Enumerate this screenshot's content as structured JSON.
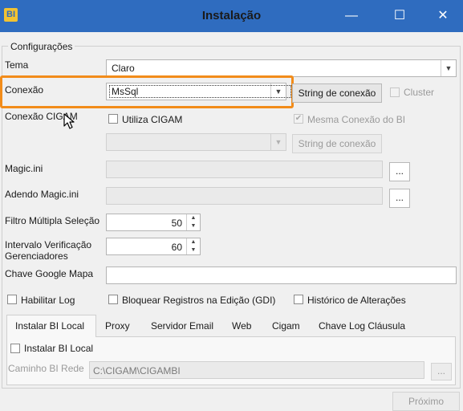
{
  "window": {
    "logo_text": "BI",
    "title": "Instalação",
    "minimize_glyph": "—",
    "maximize_glyph": "☐",
    "close_glyph": "✕"
  },
  "group": {
    "legend": "Configurações"
  },
  "tema": {
    "label": "Tema",
    "value": "Claro"
  },
  "conexao": {
    "label": "Conexão",
    "value": "MsSql",
    "string_button": "String de conexão",
    "cluster_label": "Cluster"
  },
  "conexao_cigam": {
    "label": "Conexão CIGAM",
    "utiliza_label": "Utiliza CIGAM",
    "mesma_conexao_label": "Mesma Conexão do BI",
    "combo_value": "",
    "string_button": "String de conexão"
  },
  "magic_ini": {
    "label": "Magic.ini",
    "value": "",
    "browse_label": "..."
  },
  "adendo_magic": {
    "label": "Adendo Magic.ini",
    "value": "",
    "browse_label": "..."
  },
  "filtro": {
    "label": "Filtro Múltipla Seleção",
    "value": "50"
  },
  "intervalo": {
    "label_line1": "Intervalo Verificação",
    "label_line2": "Gerenciadores",
    "value": "60"
  },
  "chave_google": {
    "label": "Chave Google Mapa",
    "value": ""
  },
  "options": {
    "habilitar_log": "Habilitar Log",
    "bloquear_registros": "Bloquear Registros na Edição (GDI)",
    "historico": "Histórico de Alterações"
  },
  "tabs": [
    {
      "label": "Instalar BI Local"
    },
    {
      "label": "Proxy"
    },
    {
      "label": "Servidor Email"
    },
    {
      "label": "Web"
    },
    {
      "label": "Cigam"
    },
    {
      "label": "Chave Log Cláusula"
    }
  ],
  "tab_panel": {
    "instalar_label": "Instalar BI Local",
    "caminho_label": "Caminho BI Rede",
    "caminho_value": "C:\\CIGAM\\CIGAMBI",
    "browse_label": "..."
  },
  "footer": {
    "next_label": "Próximo"
  },
  "colors": {
    "titlebar": "#2f6cbf",
    "highlight": "#f28c1a"
  }
}
